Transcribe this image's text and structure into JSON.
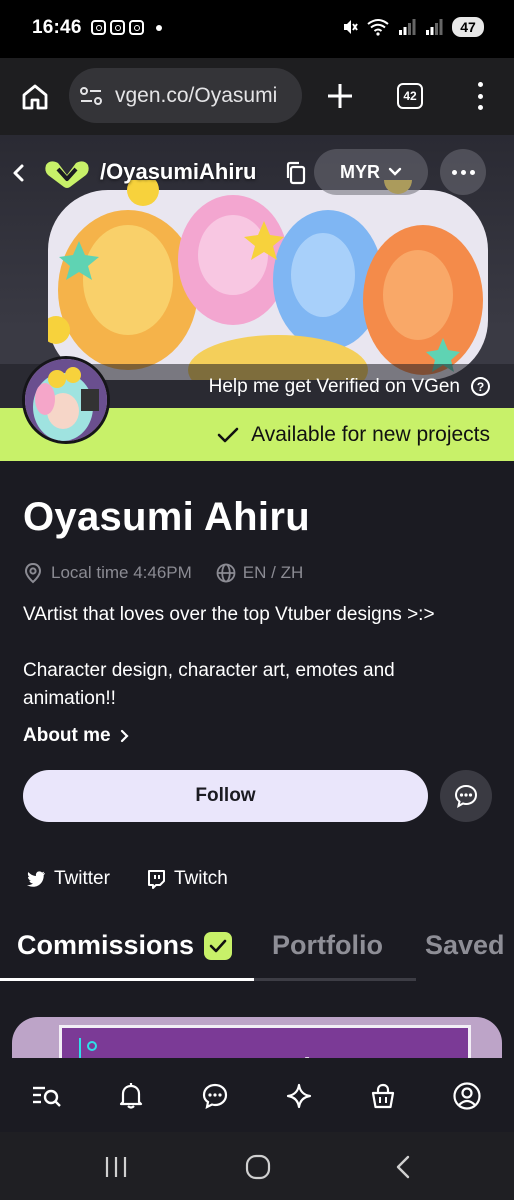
{
  "status_bar": {
    "time": "16:46",
    "battery": "47",
    "icons": [
      "instagram-icon",
      "instagram-icon",
      "instagram-icon",
      "dot-icon",
      "mute-icon",
      "wifi-icon",
      "signal-icon",
      "signal-icon"
    ]
  },
  "browser": {
    "url": "vgen.co/Oyasumi",
    "tab_count": "42",
    "icons": [
      "home-icon",
      "site-settings-icon",
      "plus-icon",
      "tabs-icon",
      "more-vert-icon"
    ]
  },
  "header": {
    "handle": "/OyasumiAhiru",
    "currency": "MYR",
    "verify_text": "Help me get Verified on VGen",
    "availability": "Available for new projects"
  },
  "profile": {
    "name": "Oyasumi Ahiru",
    "local_time": "Local time 4:46PM",
    "languages": "EN / ZH",
    "bio_line1": "VArtist that loves over the top Vtuber designs >:>",
    "bio_line2": "Character design, character art, emotes and",
    "bio_line3": "animation!!",
    "about_label": "About me",
    "follow_label": "Follow",
    "socials": [
      {
        "label": "Twitter",
        "icon": "twitter-icon"
      },
      {
        "label": "Twitch",
        "icon": "twitch-icon"
      }
    ]
  },
  "tabs": [
    {
      "label": "Commissions",
      "active": true
    },
    {
      "label": "Portfolio",
      "active": false
    },
    {
      "label": "Saved",
      "active": false
    }
  ],
  "card": {
    "preview_text": "emotes"
  },
  "bottom_nav": [
    "search-list-icon",
    "bell-icon",
    "chat-icon",
    "sparkle-icon",
    "bag-icon",
    "profile-icon"
  ],
  "system_nav": [
    "recents-icon",
    "home-circle-icon",
    "back-icon"
  ],
  "colors": {
    "accent_lime": "#c8f169",
    "background": "#1b1b22",
    "follow_bg": "#eae6fb",
    "muted_text": "#8b8b93"
  }
}
